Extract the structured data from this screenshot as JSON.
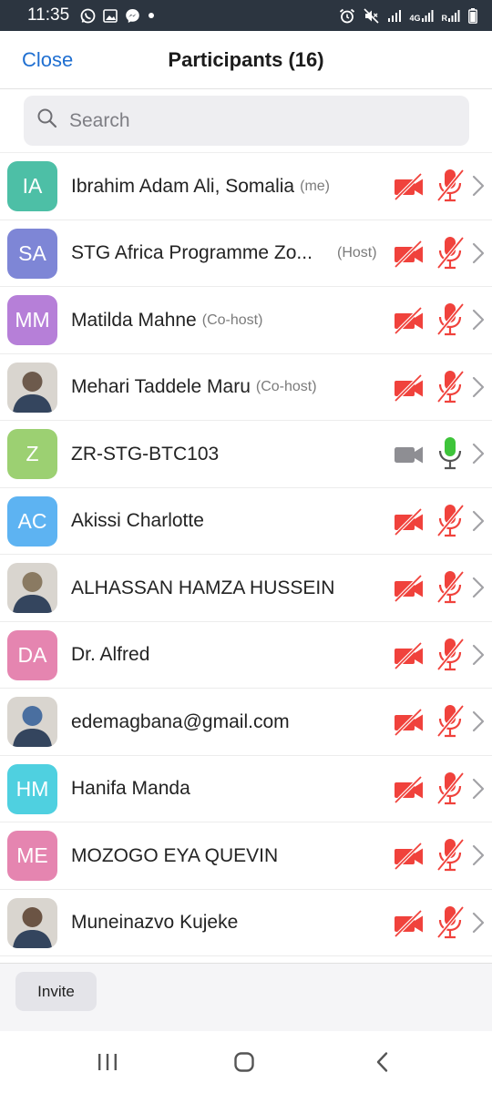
{
  "status_bar": {
    "time": "11:35",
    "left_icons": [
      "whatsapp-icon",
      "gallery-icon",
      "messenger-icon",
      "dot-icon"
    ],
    "right_icons": [
      "alarm-icon",
      "mute-icon",
      "wifi-signal-icon",
      "4g-signal-icon",
      "roaming-signal-icon",
      "battery-icon"
    ],
    "network_label": "4G",
    "roaming_label": "R"
  },
  "header": {
    "close_label": "Close",
    "title": "Participants (16)"
  },
  "search": {
    "placeholder": "Search"
  },
  "participants": [
    {
      "initials": "IA",
      "name": "Ibrahim Adam Ali, Somalia",
      "role": "(me)",
      "color": "#4dbfa6",
      "video": "off",
      "audio": "muted"
    },
    {
      "initials": "SA",
      "name": "STG Africa Programme Zo...",
      "role": "(Host)",
      "color": "#7e86d6",
      "video": "off",
      "audio": "muted"
    },
    {
      "initials": "MM",
      "name": "Matilda Mahne",
      "role": "(Co-host)",
      "color": "#b67fd8",
      "video": "off",
      "audio": "muted"
    },
    {
      "initials": "",
      "name": "Mehari Taddele Maru",
      "role": "(Co-host)",
      "color": "#6d5a4c",
      "video": "off",
      "audio": "muted"
    },
    {
      "initials": "Z",
      "name": "ZR-STG-BTC103",
      "role": "",
      "color": "#9cd072",
      "video": "available",
      "audio": "on"
    },
    {
      "initials": "AC",
      "name": "Akissi Charlotte",
      "role": "",
      "color": "#5db3f2",
      "video": "off",
      "audio": "muted"
    },
    {
      "initials": "",
      "name": "ALHASSAN HAMZA HUSSEIN",
      "role": "",
      "color": "#8a7a62",
      "video": "off",
      "audio": "muted"
    },
    {
      "initials": "DA",
      "name": "Dr. Alfred",
      "role": "",
      "color": "#e585b0",
      "video": "off",
      "audio": "muted"
    },
    {
      "initials": "",
      "name": "edemagbana@gmail.com",
      "role": "",
      "color": "#4a6fa0",
      "video": "off",
      "audio": "muted"
    },
    {
      "initials": "HM",
      "name": "Hanifa Manda",
      "role": "",
      "color": "#4fd0e0",
      "video": "off",
      "audio": "muted"
    },
    {
      "initials": "ME",
      "name": "MOZOGO EYA QUEVIN",
      "role": "",
      "color": "#e585b0",
      "video": "off",
      "audio": "muted"
    },
    {
      "initials": "",
      "name": "Muneinazvo Kujeke",
      "role": "",
      "color": "#6b5444",
      "video": "off",
      "audio": "muted"
    }
  ],
  "footer": {
    "invite_label": "Invite"
  },
  "nav_bar": {
    "buttons": [
      "recent-apps-icon",
      "home-icon",
      "back-icon"
    ]
  },
  "colors": {
    "accent_blue": "#1f6fd1",
    "muted_red": "#f0423c",
    "mic_on_green": "#3ec43a",
    "video_gray": "#8e8e93",
    "status_bar_bg": "#2c3540"
  }
}
